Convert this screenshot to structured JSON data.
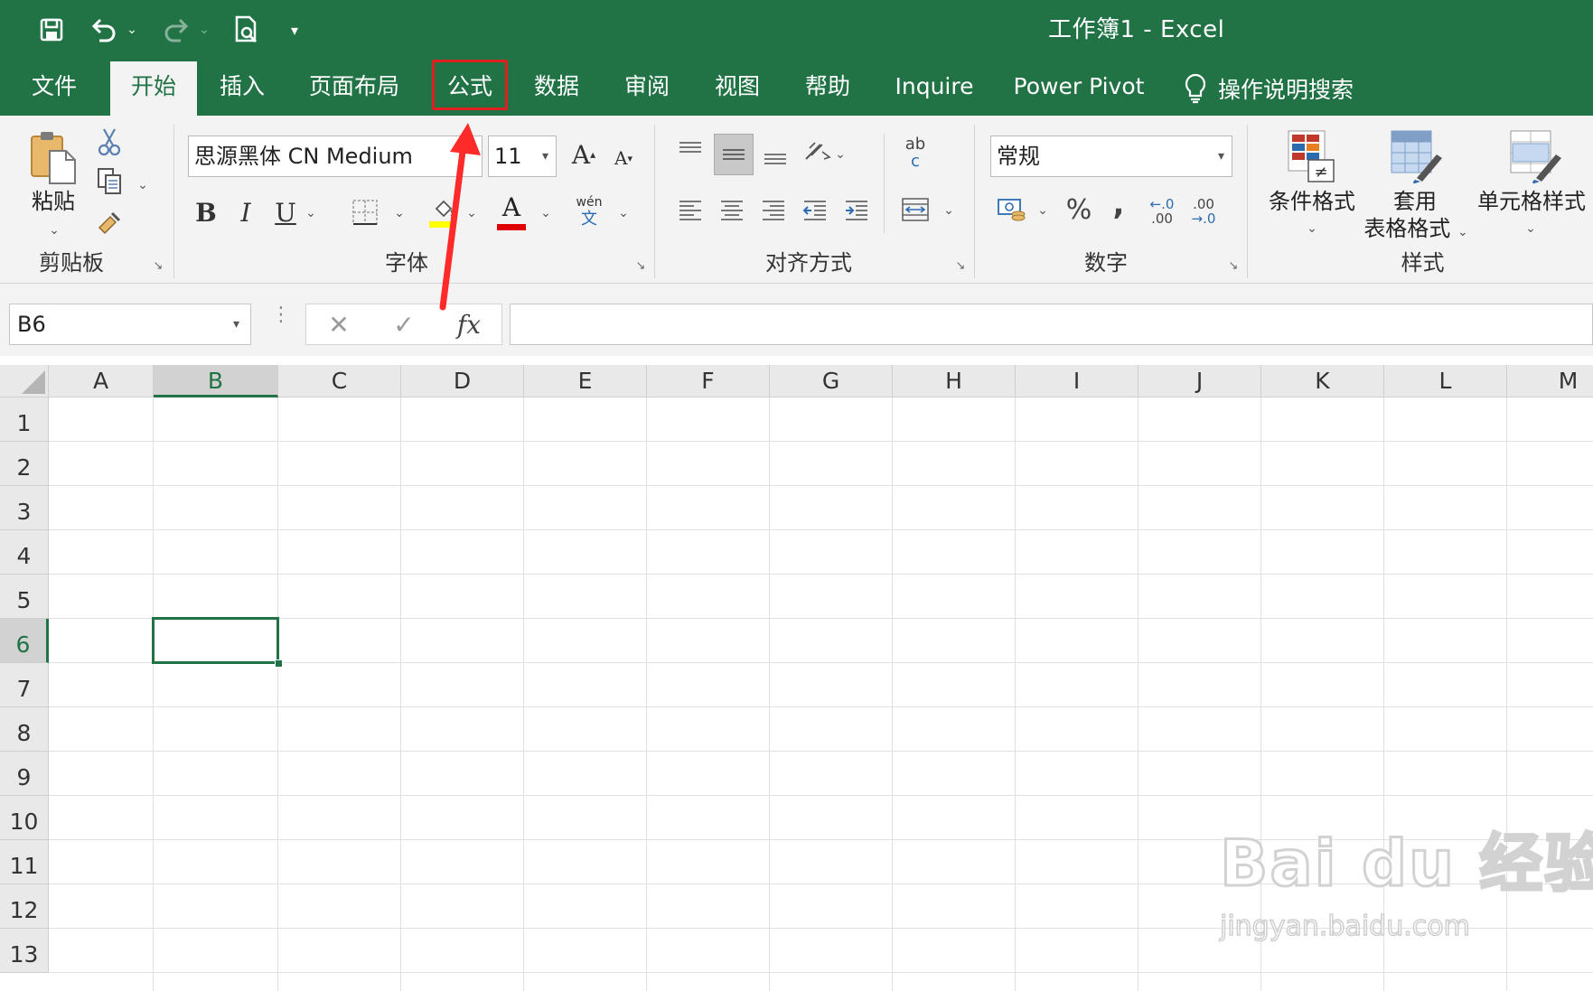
{
  "window": {
    "title": "工作簿1  -  Excel"
  },
  "tabs": [
    {
      "label": "文件"
    },
    {
      "label": "开始"
    },
    {
      "label": "插入"
    },
    {
      "label": "页面布局"
    },
    {
      "label": "公式"
    },
    {
      "label": "数据"
    },
    {
      "label": "审阅"
    },
    {
      "label": "视图"
    },
    {
      "label": "帮助"
    },
    {
      "label": "Inquire"
    },
    {
      "label": "Power Pivot"
    }
  ],
  "active_tab": "开始",
  "highlighted_tab": "公式",
  "tell_me": {
    "label": "操作说明搜索"
  },
  "ribbon": {
    "clipboard": {
      "paste_label": "粘贴",
      "group_label": "剪贴板"
    },
    "font": {
      "font_name": "思源黑体 CN Medium",
      "font_size": "11",
      "bold": "B",
      "italic": "I",
      "underline": "U",
      "grow": "A",
      "shrink": "A",
      "font_color_letter": "A",
      "phonetic_top": "wén",
      "phonetic_bottom": "文",
      "group_label": "字体",
      "highlight_color": "#ffff00",
      "font_color": "#e00000"
    },
    "alignment": {
      "wrap_top": "ab",
      "wrap_bottom": "c",
      "group_label": "对齐方式"
    },
    "number": {
      "format": "常规",
      "percent": "%",
      "comma": ",",
      "inc_decimal_top": "←.0",
      "inc_decimal_bottom": ".00",
      "dec_decimal_top": ".00",
      "dec_decimal_bottom": "→.0",
      "group_label": "数字"
    },
    "styles": {
      "conditional_format": "条件格式",
      "table_format_line1": "套用",
      "table_format_line2": "表格格式",
      "cell_styles": "单元格样式",
      "group_label": "样式"
    }
  },
  "formula_bar": {
    "name_box": "B6",
    "cancel_symbol": "✕",
    "enter_symbol": "✓",
    "fx_symbol": "fx",
    "formula": ""
  },
  "grid": {
    "columns": [
      "A",
      "B",
      "C",
      "D",
      "E",
      "F",
      "G",
      "H",
      "I",
      "J",
      "K",
      "L",
      "M"
    ],
    "rows": [
      "1",
      "2",
      "3",
      "4",
      "5",
      "6",
      "7",
      "8",
      "9",
      "10",
      "11",
      "12",
      "13"
    ],
    "selected_column": "B",
    "selected_row": "6",
    "active_cell": "B6"
  },
  "watermark": {
    "logo": "Bai du 经验",
    "url": "jingyan.baidu.com"
  },
  "colors": {
    "excel_green": "#217346",
    "ribbon_bg": "#f3f3f3",
    "highlight_box": "#e02020",
    "arrow": "#ff2a2a"
  }
}
